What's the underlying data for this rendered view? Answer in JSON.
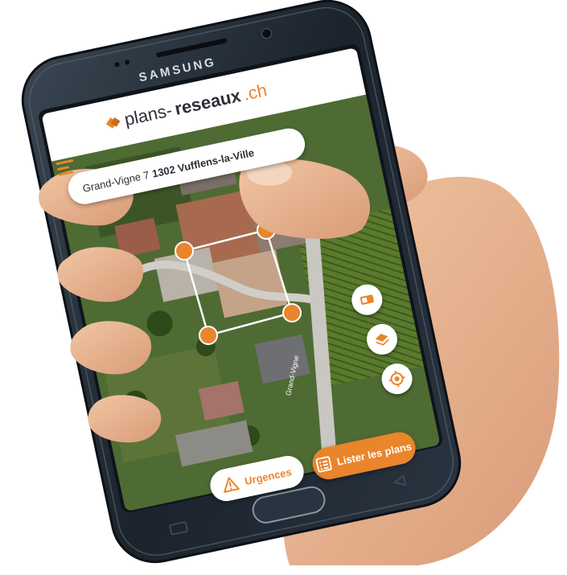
{
  "device": {
    "brand": "SAMSUNG"
  },
  "app": {
    "logo_prefix": "plans-",
    "logo_strong": "reseaux",
    "logo_tld": ".ch",
    "address_street": "Grand-Vigne 7",
    "address_locality": "1302 Vufflens-la-Ville"
  },
  "actions": {
    "urgences_label": "Urgences",
    "list_plans_label": "Lister les plans"
  },
  "map": {
    "road_label": "Grand-Vigne"
  },
  "side_buttons": [
    {
      "icon": "eraser-icon"
    },
    {
      "icon": "layers-icon"
    },
    {
      "icon": "locate-icon"
    }
  ],
  "colors": {
    "accent": "#e9852b",
    "phone_body": "#1f2833",
    "screen_bezel": "#0f141b"
  }
}
